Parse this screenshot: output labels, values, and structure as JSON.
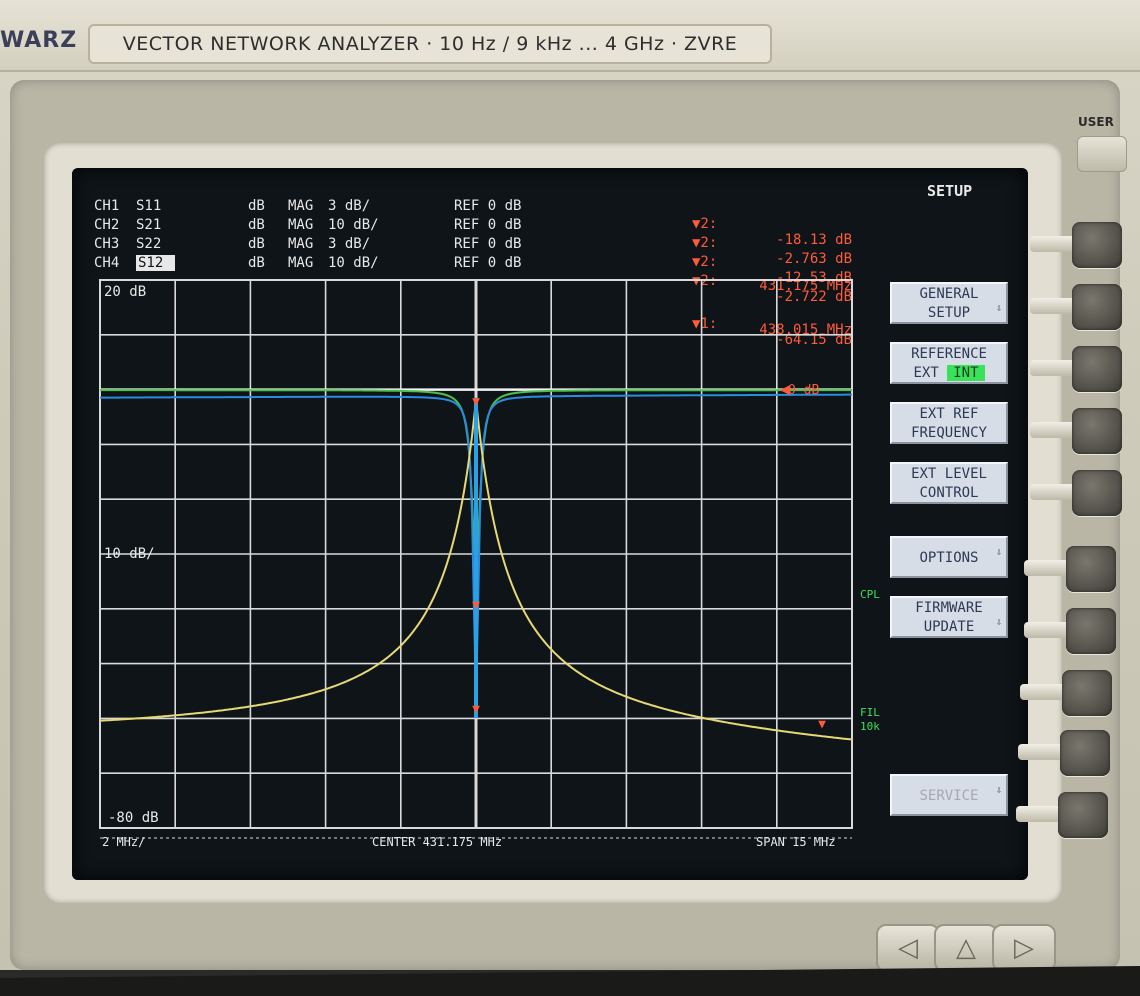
{
  "instrument": {
    "brand_fragment": "WARZ",
    "title": "VECTOR NETWORK ANALYZER · 10 Hz / 9 kHz ... 4 GHz · ZVRE",
    "user_label": "USER"
  },
  "channels": [
    {
      "label": "CH1",
      "param": "S11",
      "unit": "dB",
      "format": "MAG",
      "scale": "3 dB/",
      "ref": "REF 0 dB"
    },
    {
      "label": "CH2",
      "param": "S21",
      "unit": "dB",
      "format": "MAG",
      "scale": "10 dB/",
      "ref": "REF 0 dB"
    },
    {
      "label": "CH3",
      "param": "S22",
      "unit": "dB",
      "format": "MAG",
      "scale": "3 dB/",
      "ref": "REF 0 dB"
    },
    {
      "label": "CH4",
      "param": "S12",
      "unit": "dB",
      "format": "MAG",
      "scale": "10 dB/",
      "ref": "REF 0 dB"
    }
  ],
  "markers": [
    {
      "symbol": "▼2:",
      "value": "-18.13 dB"
    },
    {
      "symbol": "▼2:",
      "value": "-2.763 dB"
    },
    {
      "symbol": "▼2:",
      "value": "-12.53 dB"
    },
    {
      "symbol": "▼2:",
      "value": "-2.722 dB"
    },
    {
      "symbol": "",
      "value": "431.175 MHz"
    },
    {
      "symbol": "▼1:",
      "value": "-64.15 dB"
    },
    {
      "symbol": "",
      "value": "438.015 MHz"
    }
  ],
  "plot": {
    "top_label": "20 dB",
    "mid_label": "10 dB/",
    "bottom_label": "-80 dB",
    "left_scale": "2 MHz/",
    "center": "CENTER 431.175 MHz",
    "span": "SPAN 15 MHz",
    "ref_marker": "0 dB",
    "side_cpl": "CPL",
    "side_fil": "FIL",
    "side_fil2": "10k"
  },
  "menu": {
    "title": "SETUP",
    "softkeys": [
      {
        "lines": [
          "GENERAL",
          "SETUP"
        ],
        "arrow": true
      },
      {
        "lines": [
          "REFERENCE",
          "EXT"
        ],
        "int_label": "INT"
      },
      {
        "lines": [
          "EXT REF",
          "FREQUENCY"
        ]
      },
      {
        "lines": [
          "EXT LEVEL",
          "CONTROL"
        ]
      },
      {
        "lines": [
          "OPTIONS"
        ],
        "arrow": true
      },
      {
        "lines": [
          "FIRMWARE",
          "UPDATE"
        ],
        "arrow": true
      },
      {
        "lines": [
          "SERVICE"
        ],
        "arrow": true,
        "dim": true
      }
    ]
  },
  "chart_data": {
    "type": "line",
    "title": "",
    "xlabel": "",
    "ylabel": "",
    "x_center_MHz": 431.175,
    "x_span_MHz": 15,
    "ylim": [
      -80,
      20
    ],
    "colors": {
      "grid": "#d9d9d9",
      "green": "#4cc24a",
      "blue": "#2a8ce0",
      "yellow": "#e6d874",
      "marker": "#ff5b3a"
    }
  }
}
